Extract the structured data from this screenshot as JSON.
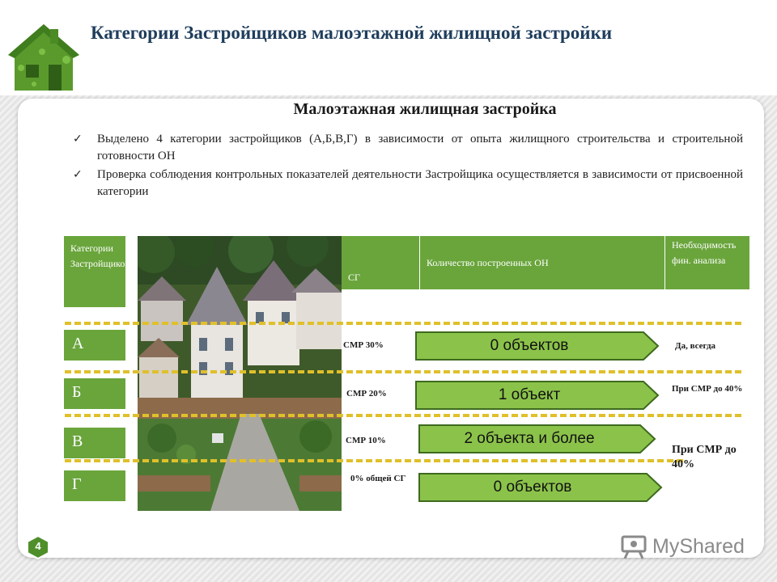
{
  "header": {
    "title": "Категории Застройщиков малоэтажной жилищной застройки"
  },
  "content": {
    "subtitle": "Малоэтажная жилищная застройка",
    "bullets": [
      "Выделено 4 категории застройщиков (А,Б,В,Г) в зависимости от опыта жилищного строительства и строительной готовности ОН",
      "Проверка соблюдения контрольных показателей деятельности Застройщика осуществляется в зависимости от присвоенной категории"
    ]
  },
  "table": {
    "col_categories": "Категории Застройщиков",
    "col_sg": "СГ",
    "col_objects": "Количество построенных ОН",
    "col_analysis": "Необходимость фин. анализа",
    "rows": [
      {
        "category": "А",
        "smr": "СМР 30%",
        "objects": "0 объектов",
        "analysis": "Да, всегда"
      },
      {
        "category": "Б",
        "smr": "СМР 20%",
        "objects": "1 объект",
        "analysis": "При СМР до 40%"
      },
      {
        "category": "В",
        "smr": "СМР 10%",
        "objects": "2 объекта и более",
        "analysis": "При СМР до 40%"
      },
      {
        "category": "Г",
        "smr": "0% общей СГ",
        "objects": "0 объектов",
        "analysis": ""
      }
    ]
  },
  "footer": {
    "page_number": "4",
    "watermark": "MyShared"
  },
  "colors": {
    "accent_green": "#6aa53c",
    "arrow_green": "#8bc34a",
    "dash_yellow": "#e0c02a",
    "title_blue": "#1f3d5c"
  },
  "icons": {
    "logo": "green-house-icon",
    "check": "check-mark-icon",
    "watermark": "presentation-board-icon"
  }
}
